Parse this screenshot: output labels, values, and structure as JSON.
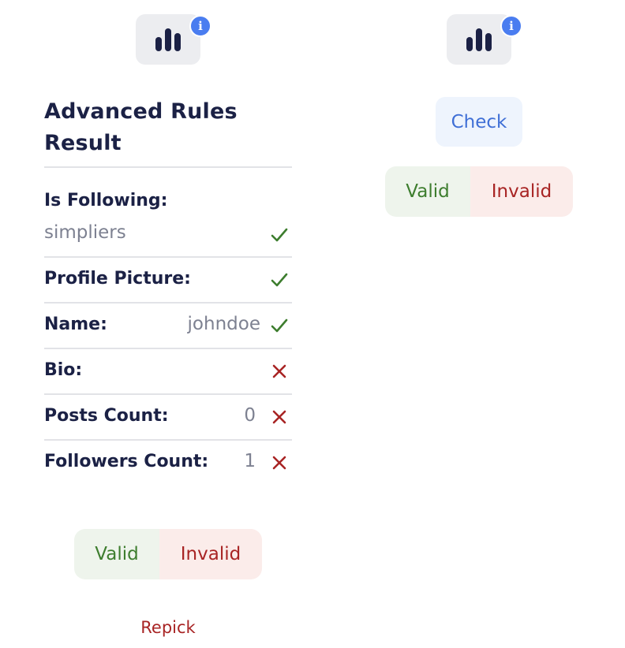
{
  "left_panel": {
    "info_badge": "i",
    "title": "Advanced Rules Result",
    "rows": [
      {
        "label": "Is Following:",
        "value": "simpliers",
        "status": "pass"
      },
      {
        "label": "Profile Picture:",
        "value": "",
        "status": "pass"
      },
      {
        "label": "Name:",
        "value": "johndoe",
        "status": "pass"
      },
      {
        "label": "Bio:",
        "value": "",
        "status": "fail"
      },
      {
        "label": "Posts Count:",
        "value": "0",
        "status": "fail"
      },
      {
        "label": "Followers Count:",
        "value": "1",
        "status": "fail"
      }
    ],
    "toggle": {
      "valid": "Valid",
      "invalid": "Invalid"
    },
    "repick": "Repick"
  },
  "right_panel": {
    "info_badge": "i",
    "check": "Check",
    "toggle": {
      "valid": "Valid",
      "invalid": "Invalid"
    }
  },
  "icons": {
    "stats": "bar-chart-icon",
    "info": "info-icon",
    "pass": "checkmark-icon",
    "fail": "cross-icon"
  },
  "colors": {
    "pass": "#3d7d2e",
    "fail": "#a82424",
    "accent": "#4a7df0",
    "text": "#1b2145"
  }
}
